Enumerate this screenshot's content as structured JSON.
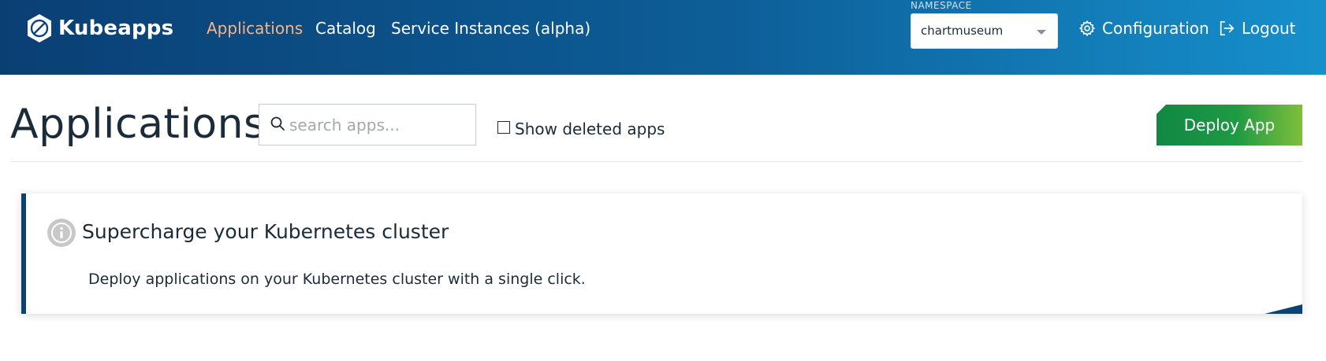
{
  "header": {
    "brand": "Kubeapps",
    "nav": [
      {
        "label": "Applications",
        "active": true
      },
      {
        "label": "Catalog",
        "active": false
      },
      {
        "label": "Service Instances (alpha)",
        "active": false
      }
    ],
    "namespace": {
      "label": "NAMESPACE",
      "value": "chartmuseum"
    },
    "configuration_label": "Configuration",
    "logout_label": "Logout"
  },
  "page": {
    "title": "Applications",
    "search": {
      "placeholder": "search apps...",
      "value": ""
    },
    "show_deleted_label": "Show deleted apps",
    "show_deleted_checked": false,
    "deploy_button": "Deploy App"
  },
  "info_card": {
    "title": "Supercharge your Kubernetes cluster",
    "text": "Deploy applications on your Kubernetes cluster with a single click."
  },
  "colors": {
    "header_start": "#0a3f74",
    "header_end": "#1690cc",
    "active_nav": "#f6b583",
    "deploy_start": "#118743",
    "deploy_end": "#7fbf3b",
    "accent": "#0b4276"
  },
  "icons": {
    "brand": "kubeapps-logo-icon",
    "configuration": "gear-icon",
    "logout": "logout-icon",
    "search": "search-icon",
    "info": "info-icon",
    "dropdown": "chevron-down-icon"
  }
}
